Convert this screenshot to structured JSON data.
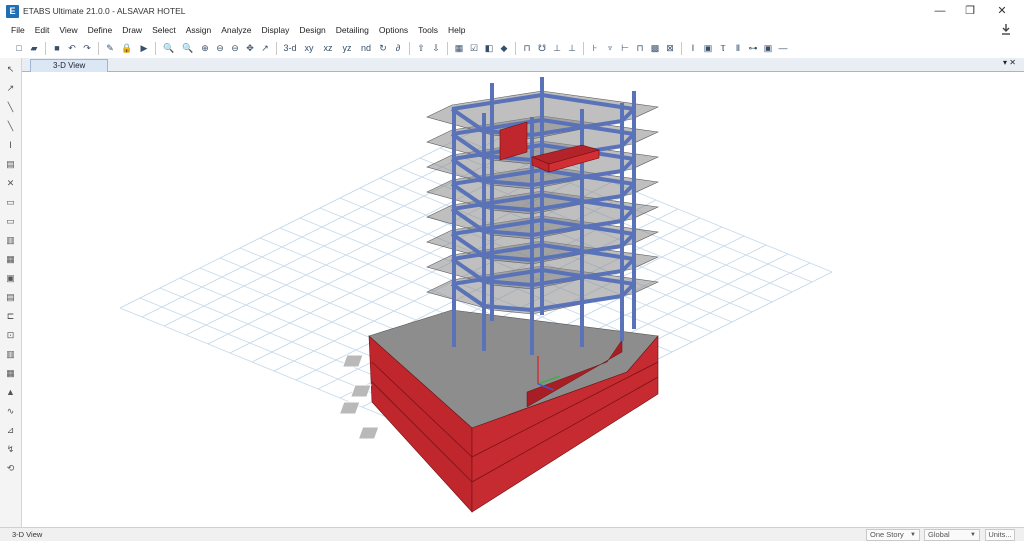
{
  "window": {
    "title": "ETABS Ultimate 21.0.0 - ALSAVAR HOTEL",
    "app_icon_letter": "E",
    "minimize": "—",
    "restore": "❐",
    "close": "✕"
  },
  "menu": {
    "items": [
      "File",
      "Edit",
      "View",
      "Define",
      "Draw",
      "Select",
      "Assign",
      "Analyze",
      "Display",
      "Design",
      "Detailing",
      "Options",
      "Tools",
      "Help"
    ]
  },
  "toolbar": {
    "buttons": [
      {
        "name": "new-model-icon",
        "glyph": "□"
      },
      {
        "name": "open-model-icon",
        "glyph": "▰"
      },
      {
        "name": "save-model-icon",
        "glyph": "■"
      },
      {
        "name": "undo-icon",
        "glyph": "↶"
      },
      {
        "name": "redo-icon",
        "glyph": "↷"
      },
      {
        "name": "refresh-icon",
        "glyph": "✎"
      },
      {
        "name": "lock-icon",
        "glyph": "🔒"
      },
      {
        "name": "run-analysis-icon",
        "glyph": "▶"
      },
      {
        "name": "zoom-window-icon",
        "glyph": "🔍"
      },
      {
        "name": "zoom-restore-icon",
        "glyph": "🔍"
      },
      {
        "name": "zoom-in-icon",
        "glyph": "⊕"
      },
      {
        "name": "zoom-out-icon",
        "glyph": "⊖"
      },
      {
        "name": "zoom-fit-icon",
        "glyph": "⊖"
      },
      {
        "name": "pan-icon",
        "glyph": "✥"
      },
      {
        "name": "pointer-icon",
        "glyph": "↗"
      },
      {
        "name": "view-3d-icon",
        "glyph": "3-d"
      },
      {
        "name": "view-plan-icon",
        "glyph": "xy"
      },
      {
        "name": "view-elevation-icon",
        "glyph": "xz"
      },
      {
        "name": "view-yz-icon",
        "glyph": "yz"
      },
      {
        "name": "view-nd-icon",
        "glyph": "nd"
      },
      {
        "name": "rotate-3d-icon",
        "glyph": "↻"
      },
      {
        "name": "perspective-icon",
        "glyph": "∂"
      },
      {
        "name": "move-up-icon",
        "glyph": "⇧"
      },
      {
        "name": "move-down-icon",
        "glyph": "⇩"
      },
      {
        "name": "set-display-icon",
        "glyph": "▦"
      },
      {
        "name": "object-shrink-icon",
        "glyph": "☑"
      },
      {
        "name": "set-building-view-icon",
        "glyph": "◧"
      },
      {
        "name": "extrude-icon",
        "glyph": "◆"
      },
      {
        "name": "draw-beam-icon",
        "glyph": "⊓"
      },
      {
        "name": "draw-brace-icon",
        "glyph": "☋"
      },
      {
        "name": "draw-column-icon",
        "glyph": "⊥"
      },
      {
        "name": "draw-wall-icon",
        "glyph": "⊥"
      },
      {
        "name": "draw-slab-icon",
        "glyph": "⊦"
      },
      {
        "name": "draw-joint-icon",
        "glyph": "♆"
      },
      {
        "name": "draw-link-icon",
        "glyph": "⊢"
      },
      {
        "name": "draw-frame-icon",
        "glyph": "⊓"
      },
      {
        "name": "draw-area-icon",
        "glyph": "▩"
      },
      {
        "name": "draw-opening-icon",
        "glyph": "⊠"
      },
      {
        "name": "draw-dimension-icon",
        "glyph": "Ⅰ"
      },
      {
        "name": "draw-section-cut-icon",
        "glyph": "▣"
      },
      {
        "name": "draw-tendon-icon",
        "glyph": "Ⲧ"
      },
      {
        "name": "draw-rebar-icon",
        "glyph": "Ⅱ"
      },
      {
        "name": "draw-developed-icon",
        "glyph": "⊶"
      },
      {
        "name": "draw-reference-icon",
        "glyph": "▣"
      },
      {
        "name": "draw-line-icon",
        "glyph": "—"
      }
    ]
  },
  "left_tools": [
    "select-pointer-icon",
    "reshape-icon",
    "draw-line-icon",
    "draw-frame-icon",
    "draw-column-icon",
    "draw-beam-grid-icon",
    "draw-brace-icon",
    "draw-floor-icon",
    "draw-area-icon",
    "draw-wall-icon",
    "draw-opening-icon",
    "draw-window-icon",
    "draw-door-icon",
    "draw-stair-icon",
    "draw-link-icon",
    "draw-panel-icon",
    "draw-ramp-icon",
    "draw-spring-icon",
    "draw-edge-icon",
    "draw-dimension-icon",
    "zoom-snap-icon",
    "snap-options-icon"
  ],
  "tabs": {
    "active": "3-D View"
  },
  "statusbar": {
    "view_label": "3-D View",
    "story_dropdown": "One Story",
    "coord_dropdown": "Global",
    "units_button": "Units..."
  },
  "colors": {
    "frame_blue": "#5a73b8",
    "wall_red": "#c0272d",
    "slab_gray": "#8a8a8a",
    "grid_line": "#c4d8ea"
  }
}
